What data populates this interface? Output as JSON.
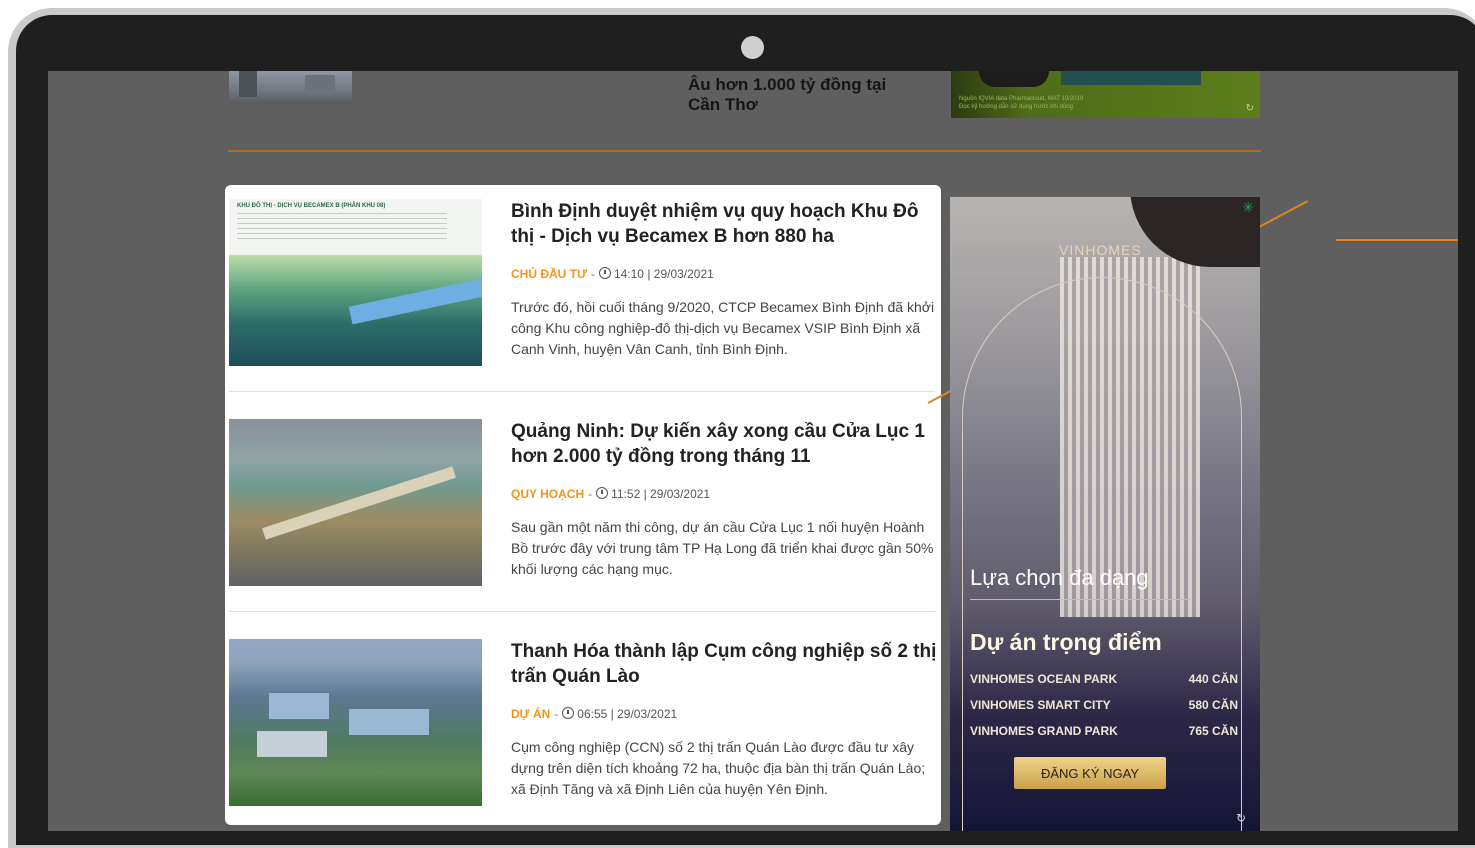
{
  "top_story": {
    "title_line_1": "Âu hơn 1.000 tỷ đồng tại",
    "title_line_2": "Cần Thơ"
  },
  "top_ad": {
    "note_line_1": "Nguồn IQVIA data Pharmacloud, MAT 10/2019",
    "note_line_2": "Đọc kỹ hướng dẫn sử dụng trước khi dùng"
  },
  "news": [
    {
      "title": "Bình Định duyệt nhiệm vụ quy hoạch Khu Đô thị - Dịch vụ Becamex B hơn 880 ha",
      "category": "CHỦ ĐẦU TƯ",
      "time": "14:10 | 29/03/2021",
      "excerpt": "Trước đó, hồi cuối tháng 9/2020, CTCP Becamex Bình Định đã khởi công Khu công nghiệp-đô thị-dịch vụ Becamex VSIP Bình Định xã Canh Vinh, huyện Vân Canh, tỉnh Bình Định.",
      "thumb_text": "KHU ĐÔ THỊ - DỊCH VỤ BECAMEX B (PHÂN KHU 08)"
    },
    {
      "title": "Quảng Ninh: Dự kiến xây xong cầu Cửa Lục 1 hơn 2.000 tỷ đồng trong tháng 11",
      "category": "QUY HOẠCH",
      "time": "11:52 | 29/03/2021",
      "excerpt": "Sau gần một năm thi công, dự án cầu Cửa Lục 1 nối huyện Hoành Bồ trước đây với trung tâm TP Hạ Long đã triển khai được gần 50% khối lượng các hạng mục."
    },
    {
      "title": "Thanh Hóa thành lập Cụm công nghiệp số 2 thị trấn Quán Lào",
      "category": "DỰ ÁN",
      "time": "06:55 | 29/03/2021",
      "excerpt": "Cụm công nghiệp (CCN) số 2 thị trấn Quán Lào được đầu tư xây dựng trên diện tích khoảng 72 ha, thuộc địa bàn thị trấn Quán Lào; xã Định Tăng và xã Định Liên của huyện Yên Định."
    }
  ],
  "ad": {
    "logo": "VINHOMES",
    "headline": "Lựa chọn đa dạng",
    "subtitle": "Dự án trọng điểm",
    "projects": [
      {
        "name": "VINHOMES OCEAN PARK",
        "units": "440 CĂN"
      },
      {
        "name": "VINHOMES SMART CITY",
        "units": "580 CĂN"
      },
      {
        "name": "VINHOMES GRAND PARK",
        "units": "765 CĂN"
      }
    ],
    "cta": "ĐĂNG KÝ NGAY"
  },
  "icons": {
    "clock": "clock-icon",
    "refresh": "refresh-icon",
    "adchoices": "adchoices-icon"
  },
  "colors": {
    "category": "#f39318",
    "divider": "#b36a19",
    "overlay": "#5f5f5f"
  }
}
